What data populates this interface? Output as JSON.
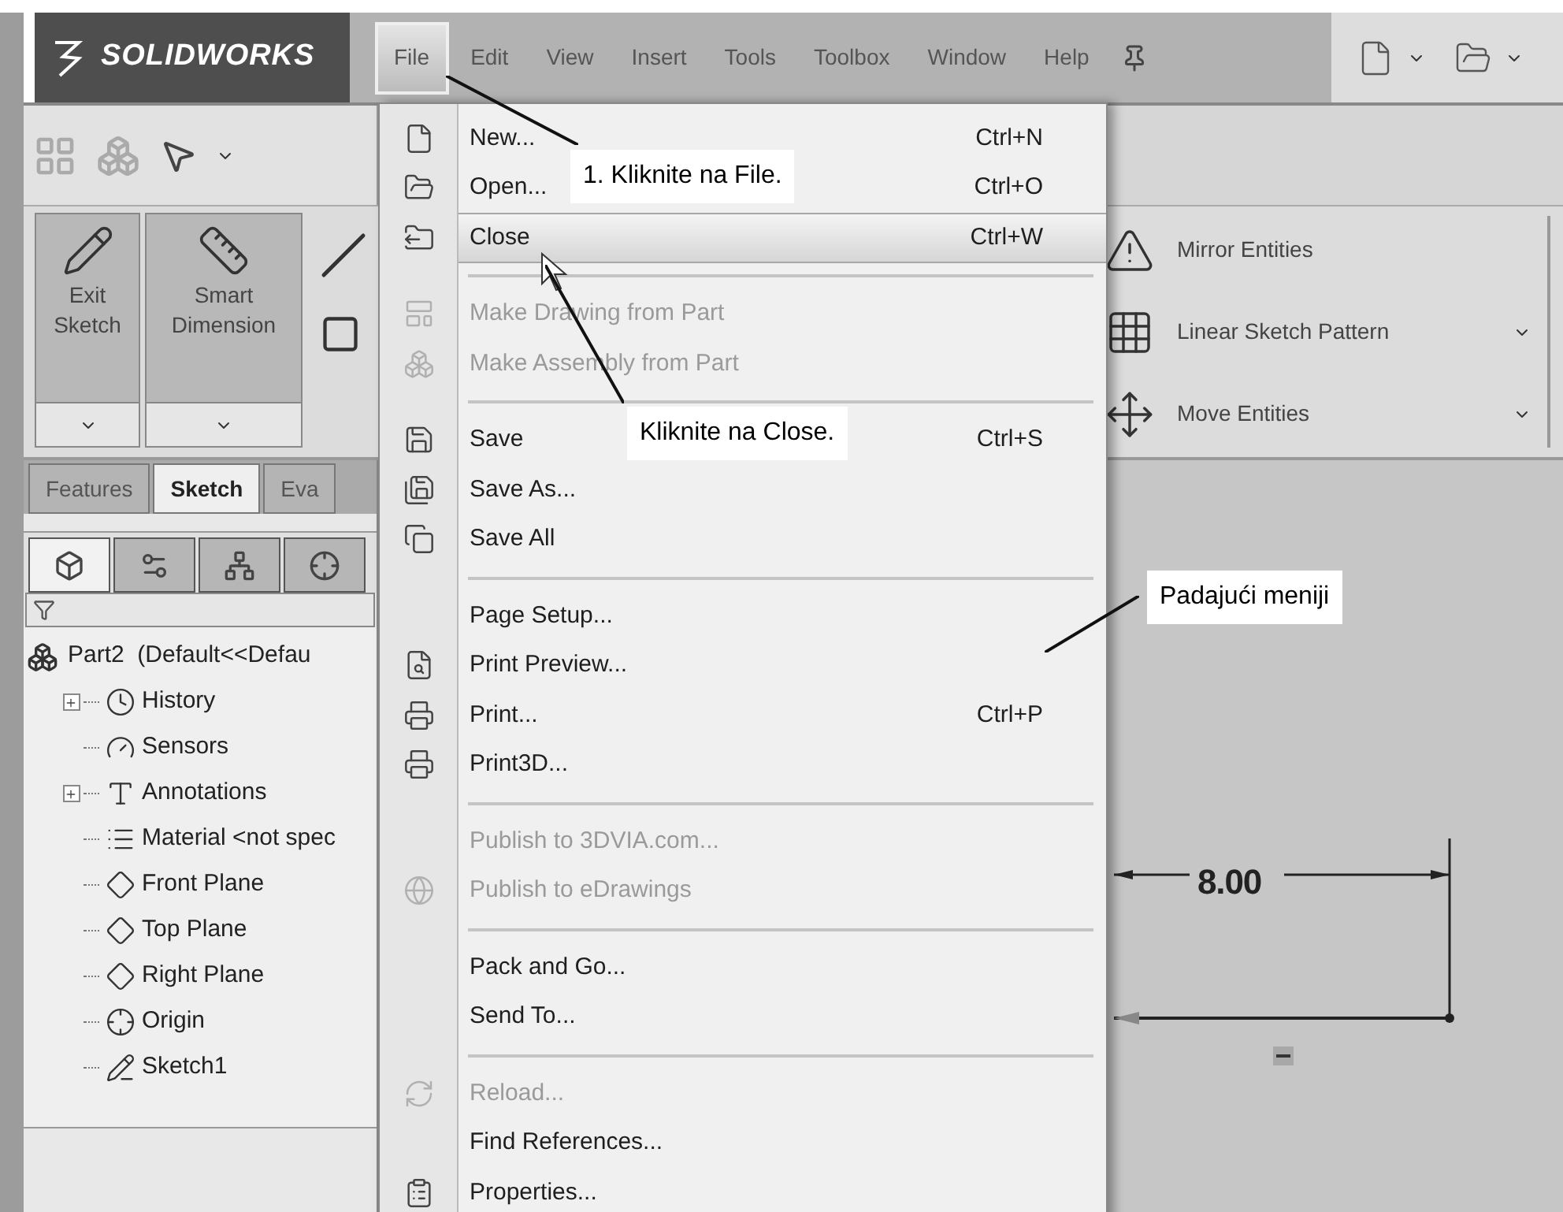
{
  "logo": {
    "text": "SOLIDWORKS"
  },
  "menu_bar": [
    {
      "label": "File",
      "selected": true
    },
    {
      "label": "Edit",
      "selected": false
    },
    {
      "label": "View",
      "selected": false
    },
    {
      "label": "Insert",
      "selected": false
    },
    {
      "label": "Tools",
      "selected": false
    },
    {
      "label": "Toolbox",
      "selected": false
    },
    {
      "label": "Window",
      "selected": false
    },
    {
      "label": "Help",
      "selected": false
    }
  ],
  "ribbon": {
    "large_buttons": [
      {
        "label": "Exit Sketch"
      },
      {
        "label": "Smart Dimension"
      }
    ],
    "tools": [
      {
        "label": "Mirror Entities",
        "dropdown": false
      },
      {
        "label": "Linear Sketch Pattern",
        "dropdown": true
      },
      {
        "label": "Move Entities",
        "dropdown": true
      }
    ]
  },
  "panel_tabs": [
    {
      "label": "Features",
      "selected": false
    },
    {
      "label": "Sketch",
      "selected": true
    },
    {
      "label": "Eva",
      "selected": false
    }
  ],
  "view_tabs": [
    {
      "selected": true
    },
    {
      "selected": false
    },
    {
      "selected": false
    },
    {
      "selected": false
    }
  ],
  "tree": {
    "label": "Part2  (Default<<Defau",
    "children": [
      {
        "label": "History",
        "expandable": true
      },
      {
        "label": "Sensors",
        "expandable": false
      },
      {
        "label": "Annotations",
        "expandable": true
      },
      {
        "label": "Material <not spec",
        "expandable": false
      },
      {
        "label": "Front Plane",
        "expandable": false
      },
      {
        "label": "Top Plane",
        "expandable": false
      },
      {
        "label": "Right Plane",
        "expandable": false
      },
      {
        "label": "Origin",
        "expandable": false
      },
      {
        "label": "Sketch1",
        "expandable": false
      }
    ]
  },
  "file_menu": [
    {
      "kind": "item",
      "label": "New...",
      "shortcut": "Ctrl+N",
      "disabled": false,
      "selected": false
    },
    {
      "kind": "item",
      "label": "Open...",
      "shortcut": "Ctrl+O",
      "disabled": false,
      "selected": false
    },
    {
      "kind": "item",
      "label": "Close",
      "shortcut": "Ctrl+W",
      "disabled": false,
      "selected": true
    },
    {
      "kind": "separator"
    },
    {
      "kind": "item",
      "label": "Make Drawing from Part",
      "disabled": true,
      "selected": false
    },
    {
      "kind": "item",
      "label": "Make Assembly from Part",
      "disabled": true,
      "selected": false
    },
    {
      "kind": "separator"
    },
    {
      "kind": "item",
      "label": "Save",
      "shortcut": "Ctrl+S",
      "disabled": false,
      "selected": false
    },
    {
      "kind": "item",
      "label": "Save As...",
      "disabled": false,
      "selected": false
    },
    {
      "kind": "item",
      "label": "Save All",
      "disabled": false,
      "selected": false
    },
    {
      "kind": "separator"
    },
    {
      "kind": "item",
      "label": "Page Setup...",
      "disabled": false,
      "selected": false
    },
    {
      "kind": "item",
      "label": "Print Preview...",
      "disabled": false,
      "selected": false
    },
    {
      "kind": "item",
      "label": "Print...",
      "shortcut": "Ctrl+P",
      "disabled": false,
      "selected": false
    },
    {
      "kind": "item",
      "label": "Print3D...",
      "disabled": false,
      "selected": false
    },
    {
      "kind": "separator"
    },
    {
      "kind": "item",
      "label": "Publish to 3DVIA.com...",
      "disabled": true,
      "selected": false
    },
    {
      "kind": "item",
      "label": "Publish to eDrawings",
      "disabled": true,
      "selected": false
    },
    {
      "kind": "separator"
    },
    {
      "kind": "item",
      "label": "Pack and Go...",
      "disabled": false,
      "selected": false
    },
    {
      "kind": "item",
      "label": "Send To...",
      "disabled": false,
      "selected": false
    },
    {
      "kind": "separator"
    },
    {
      "kind": "item",
      "label": "Reload...",
      "disabled": true,
      "selected": false
    },
    {
      "kind": "item",
      "label": "Find References...",
      "disabled": false,
      "selected": false
    },
    {
      "kind": "item",
      "label": "Properties...",
      "disabled": false,
      "selected": false
    }
  ],
  "canvas": {
    "dimension": "8.00"
  },
  "callouts": [
    {
      "text": "1. Kliknite na File."
    },
    {
      "text": "Kliknite na Close."
    },
    {
      "text": "Padajući meniji"
    }
  ]
}
